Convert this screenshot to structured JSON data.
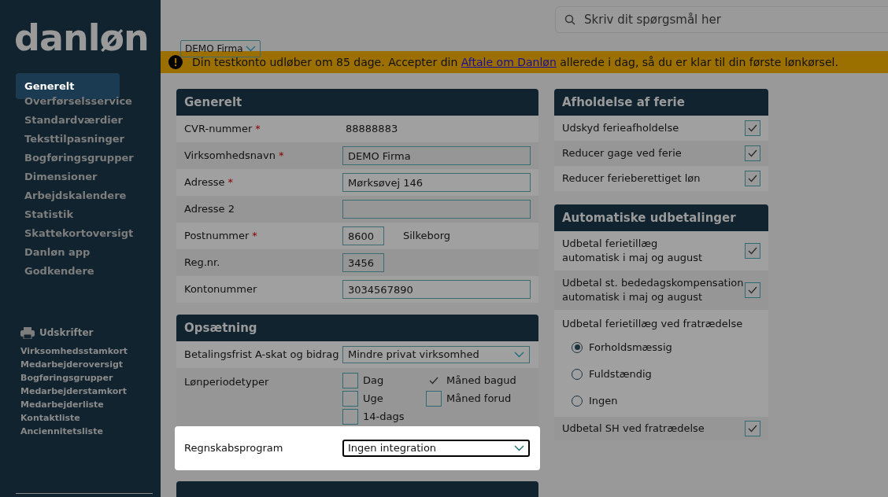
{
  "logo": "danløn",
  "search": {
    "placeholder": "Skriv dit spørgsmål her"
  },
  "company_select": {
    "value": "DEMO Firma"
  },
  "sidebar": {
    "items": [
      {
        "label": "Generelt",
        "selected": true
      },
      {
        "label": "Overførselsservice",
        "selected": false
      },
      {
        "label": "Standardværdier",
        "selected": false
      },
      {
        "label": "Teksttilpasninger",
        "selected": false
      },
      {
        "label": "Bogføringsgrupper",
        "selected": false
      },
      {
        "label": "Dimensioner",
        "selected": false
      },
      {
        "label": "Arbejdskalendere",
        "selected": false
      },
      {
        "label": "Statistik",
        "selected": false
      },
      {
        "label": "Skattekortoversigt",
        "selected": false
      },
      {
        "label": "Danløn app",
        "selected": false
      },
      {
        "label": "Godkendere",
        "selected": false
      }
    ],
    "prints_title": "Udskrifter",
    "prints": [
      "Virksomhedsstamkort",
      "Medarbejderoversigt",
      "Bogføringsgrupper",
      "Medarbejderstamkort",
      "Medarbejderliste",
      "Kontaktliste",
      "Anciennitetsliste"
    ]
  },
  "banner": {
    "before": "Din testkonto udløber om 85 dage. Accepter din",
    "link": "Aftale om Danløn",
    "after": "allerede i dag, så du er klar til din første lønkørsel."
  },
  "general": {
    "title": "Generelt",
    "rows": [
      {
        "label": "CVR-nummer",
        "required_mark": "*",
        "kind": "text",
        "value": "88888883"
      },
      {
        "label": "Virksomhedsnavn",
        "required_mark": "*",
        "kind": "input",
        "value": "DEMO Firma"
      },
      {
        "label": "Adresse",
        "required_mark": "*",
        "kind": "input",
        "value": "Mørksøvej 146"
      },
      {
        "label": "Adresse 2",
        "kind": "input"
      },
      {
        "label": "Postnummer",
        "required_mark": "*",
        "kind": "short",
        "value": "8600",
        "extra": "Silkeborg"
      },
      {
        "label": "Reg.nr.",
        "kind": "short",
        "value": "3456"
      },
      {
        "label": "Kontonummer",
        "kind": "input",
        "value": "3034567890"
      }
    ]
  },
  "setup": {
    "title": "Opsætning",
    "payment_deadline": {
      "label": "Betalingsfrist A-skat og bidrag",
      "value": "Mindre privat virksomhed"
    },
    "pay_periods": {
      "label": "Lønperiodetyper",
      "options": [
        {
          "label": "Dag",
          "checked": false
        },
        {
          "label": "Måned bagud",
          "checked": true
        },
        {
          "label": "Uge",
          "checked": false
        },
        {
          "label": "Måned forud",
          "checked": false
        },
        {
          "label": "14-dags",
          "checked": false
        }
      ]
    },
    "accounting": {
      "label": "Regnskabsprogram",
      "value": "Ingen integration",
      "highlighted": true
    }
  },
  "holiday": {
    "title": "Afholdelse af ferie",
    "rows": [
      {
        "label": "Udskyd ferieafholdelse",
        "checked": true
      },
      {
        "label": "Reducer gage ved ferie",
        "checked": true
      },
      {
        "label": "Reducer ferieberettiget løn",
        "checked": true
      }
    ]
  },
  "auto": {
    "title": "Automatiske udbetalinger",
    "rows": [
      {
        "label": "Udbetal ferietillæg\nautomatisk i maj og august",
        "checked": true
      },
      {
        "label": "Udbetal st. bededagskompensation\nautomatisk i maj og august",
        "checked": true
      }
    ],
    "resign_label": "Udbetal ferietillæg ved fratrædelse",
    "resign_options": [
      {
        "label": "Forholdsmæssig",
        "selected": true
      },
      {
        "label": "Fuldstændig",
        "selected": false
      },
      {
        "label": "Ingen",
        "selected": false
      }
    ],
    "sh": {
      "label": "Udbetal SH ved fratrædelse",
      "checked": true
    }
  }
}
